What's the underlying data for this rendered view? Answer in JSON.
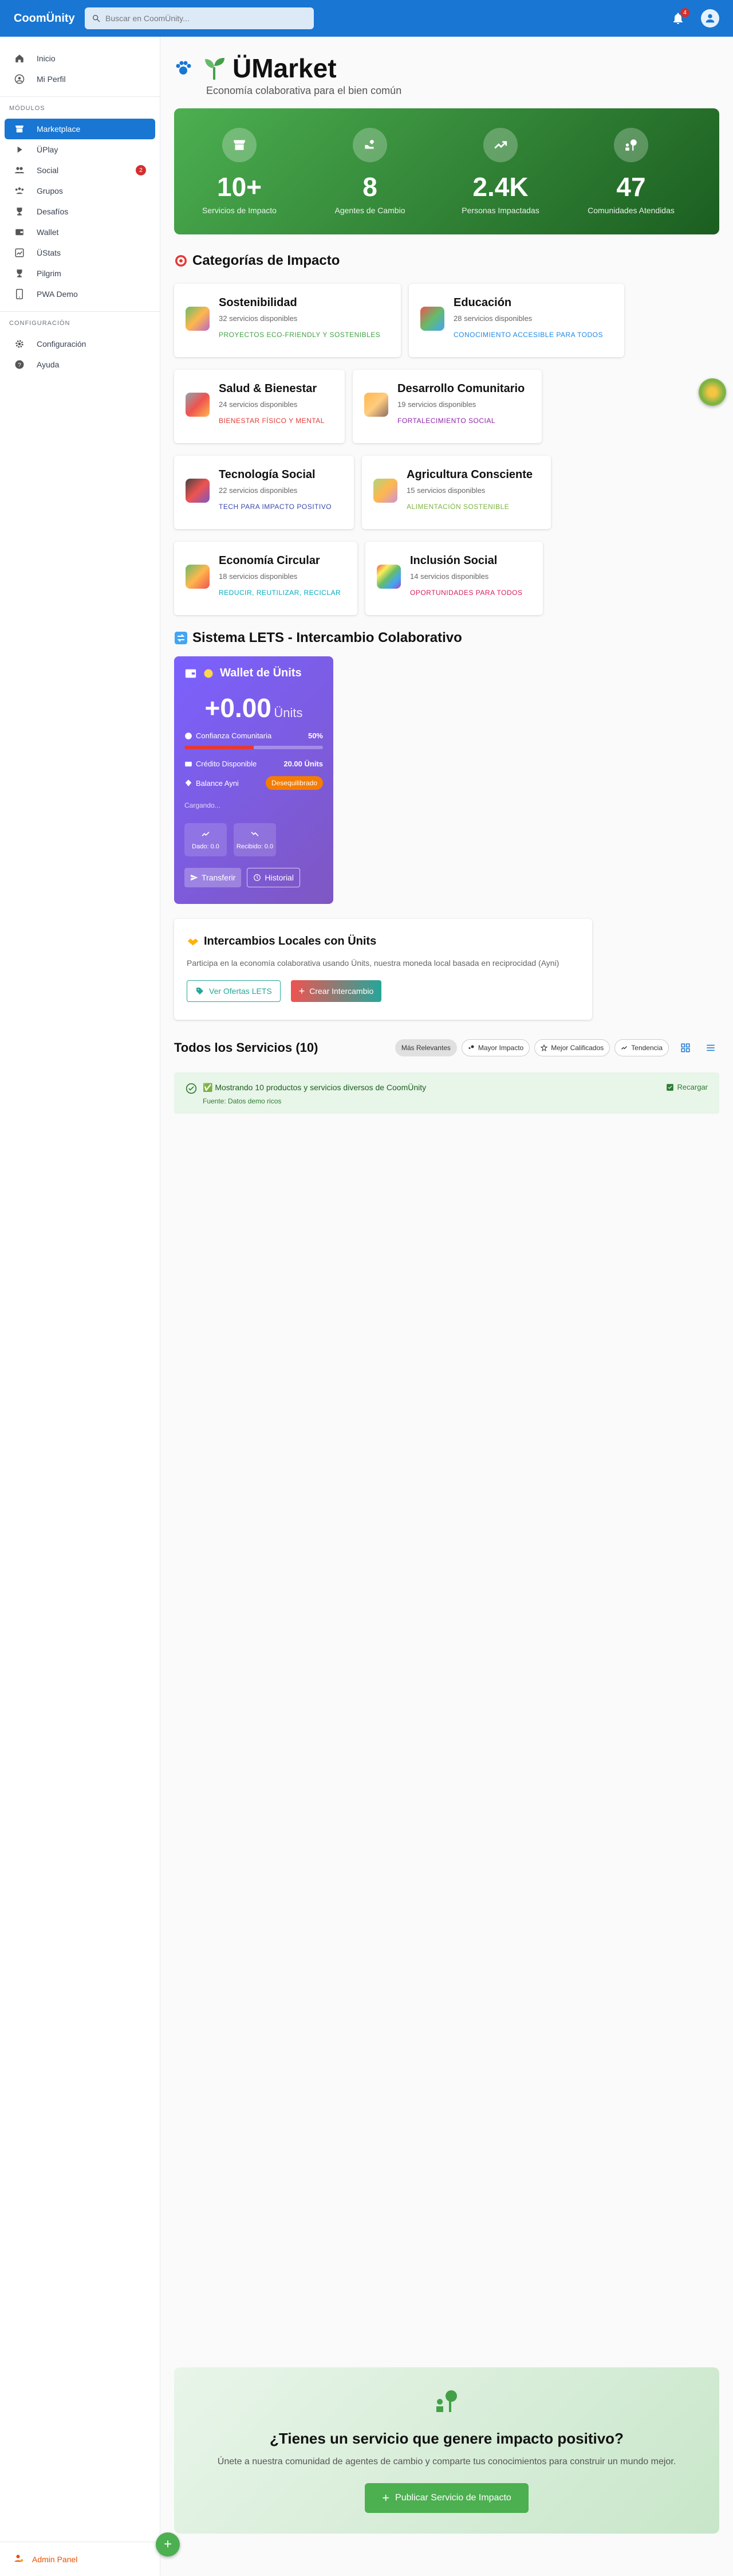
{
  "app": {
    "brand": "CoomÜnity"
  },
  "search": {
    "placeholder": "Buscar en CoomÜnity..."
  },
  "notifications": {
    "count": "4"
  },
  "sidebar": {
    "top_items": [
      {
        "label": "Inicio",
        "icon": "home-icon"
      },
      {
        "label": "Mi Perfil",
        "icon": "profile-icon"
      }
    ],
    "modules_label": "MÓDULOS",
    "modules": [
      {
        "label": "Marketplace",
        "icon": "store-icon",
        "active": true
      },
      {
        "label": "ÜPlay",
        "icon": "play-icon"
      },
      {
        "label": "Social",
        "icon": "people-icon",
        "badge": "2"
      },
      {
        "label": "Grupos",
        "icon": "groups-icon"
      },
      {
        "label": "Desafíos",
        "icon": "trophy-icon"
      },
      {
        "label": "Wallet",
        "icon": "wallet-icon"
      },
      {
        "label": "ÜStats",
        "icon": "stats-icon"
      },
      {
        "label": "Pilgrim",
        "icon": "pilgrim-icon"
      },
      {
        "label": "PWA Demo",
        "icon": "phone-icon"
      }
    ],
    "config_label": "CONFIGURACIÓN",
    "config_items": [
      {
        "label": "Configuración",
        "icon": "gear-icon"
      },
      {
        "label": "Ayuda",
        "icon": "help-icon"
      }
    ],
    "admin_label": "Admin Panel"
  },
  "hero": {
    "title": "ÜMarket",
    "subtitle": "Economía colaborativa para el bien común"
  },
  "stats": [
    {
      "value": "10+",
      "label": "Servicios de Impacto"
    },
    {
      "value": "8",
      "label": "Agentes de Cambio"
    },
    {
      "value": "2.4K",
      "label": "Personas Impactadas"
    },
    {
      "value": "47",
      "label": "Comunidades Atendidas"
    }
  ],
  "categories_title": "Categorías de Impacto",
  "categories": [
    {
      "name": "Sostenibilidad",
      "count": "32 servicios disponibles",
      "tag": "PROYECTOS ECO-FRIENDLY Y SOSTENIBLES",
      "color": "#43a047"
    },
    {
      "name": "Educación",
      "count": "28 servicios disponibles",
      "tag": "CONOCIMIENTO ACCESIBLE PARA TODOS",
      "color": "#1e88e5"
    },
    {
      "name": "Salud & Bienestar",
      "count": "24 servicios disponibles",
      "tag": "BIENESTAR FÍSICO Y MENTAL",
      "color": "#e53935"
    },
    {
      "name": "Desarrollo Comunitario",
      "count": "19 servicios disponibles",
      "tag": "FORTALECIMIENTO SOCIAL",
      "color": "#8e24aa"
    },
    {
      "name": "Tecnología Social",
      "count": "22 servicios disponibles",
      "tag": "TECH PARA IMPACTO POSITIVO",
      "color": "#3949ab"
    },
    {
      "name": "Agricultura Consciente",
      "count": "15 servicios disponibles",
      "tag": "ALIMENTACIÓN SOSTENIBLE",
      "color": "#7cb342"
    },
    {
      "name": "Economía Circular",
      "count": "18 servicios disponibles",
      "tag": "REDUCIR, REUTILIZAR, RECICLAR",
      "color": "#00acc1"
    },
    {
      "name": "Inclusión Social",
      "count": "14 servicios disponibles",
      "tag": "OPORTUNIDADES PARA TODOS",
      "color": "#d81b60"
    }
  ],
  "lets": {
    "title": "Sistema LETS - Intercambio Colaborativo",
    "wallet": {
      "title": "Wallet de Ünits",
      "amount": "+0.00",
      "unit": "Ünits",
      "trust_label": "Confianza Comunitaria",
      "trust_value": "50%",
      "trust_fraction": 0.5,
      "credit_label": "Crédito Disponible",
      "credit_value": "20.00 Ünits",
      "ayni_label": "Balance Ayni",
      "ayni_status": "Desequilibrado",
      "loading": "Cargando...",
      "given": "Dado: 0.0",
      "received": "Recibido: 0.0",
      "transfer": "Transferir",
      "history": "Historial"
    },
    "locales": {
      "title": "Intercambios Locales con Ünits",
      "description": "Participa en la economía colaborativa usando Ünits, nuestra moneda local basada en reciprocidad (Ayni)",
      "view_button": "Ver Ofertas LETS",
      "create_button": "Crear Intercambio"
    }
  },
  "services": {
    "title": "Todos los Servicios (10)",
    "filters": [
      "Más Relevantes",
      "Mayor Impacto",
      "Mejor Calificados",
      "Tendencia"
    ],
    "alert_text": "✅ Mostrando 10 productos y servicios diversos de CoomÜnity",
    "alert_source": "Fuente: Datos demo ricos",
    "reload": "Recargar"
  },
  "cta": {
    "title": "¿Tienes un servicio que genere impacto positivo?",
    "description": "Únete a nuestra comunidad de agentes de cambio y comparte tus conocimientos para construir un mundo mejor.",
    "button": "Publicar Servicio de Impacto"
  }
}
